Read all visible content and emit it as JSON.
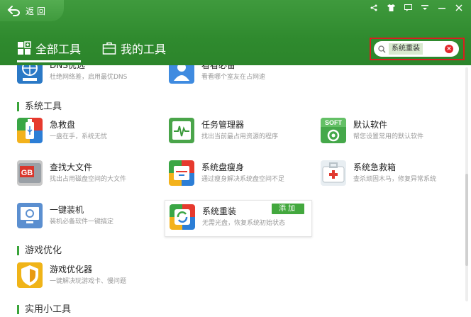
{
  "header": {
    "back_label": "返回",
    "tabs": [
      {
        "label": "全部工具",
        "icon": "grid-icon",
        "active": true
      },
      {
        "label": "我的工具",
        "icon": "briefcase-icon",
        "active": false
      }
    ],
    "search": {
      "value": "系统重装"
    },
    "accent": "#2f8a2e"
  },
  "partial_top": [
    {
      "name": "DNS优选",
      "desc": "杜绝网络差，启用最优DNS"
    },
    {
      "name": "看看必备",
      "desc": "看看哪个室友在占网速"
    }
  ],
  "sections": [
    {
      "title": "系统工具",
      "tools": [
        {
          "name": "急救盘",
          "desc": "一盘在手，系统无忧",
          "icon": "usb-drive-icon"
        },
        {
          "name": "任务管理器",
          "desc": "找出当前最占用资源的程序",
          "icon": "pulse-monitor-icon"
        },
        {
          "name": "默认软件",
          "desc": "帮您设置常用的默认软件",
          "icon": "soft-badge-icon",
          "badge": "SOFT"
        },
        {
          "name": "查找大文件",
          "desc": "找出占用磁盘空间的大文件",
          "icon": "gb-file-icon",
          "badge": "GB"
        },
        {
          "name": "系统盘瘦身",
          "desc": "通过瘦身解决系统盘空间不足",
          "icon": "drawer-icon"
        },
        {
          "name": "系统急救箱",
          "desc": "查杀顽固木马，修复异常系统",
          "icon": "firstaid-kit-icon"
        },
        {
          "name": "一键装机",
          "desc": "装机必备软件一键搞定",
          "icon": "monitor-icon"
        },
        {
          "name": "系统重装",
          "desc": "无需光盘，恢复系统初始状态",
          "icon": "reinstall-icon",
          "add_label": "添加"
        }
      ]
    },
    {
      "title": "游戏优化",
      "tools": [
        {
          "name": "游戏优化器",
          "desc": "一键解决玩游戏卡、慢问题",
          "icon": "game-shield-icon"
        }
      ]
    },
    {
      "title": "实用小工具",
      "tools": []
    }
  ]
}
